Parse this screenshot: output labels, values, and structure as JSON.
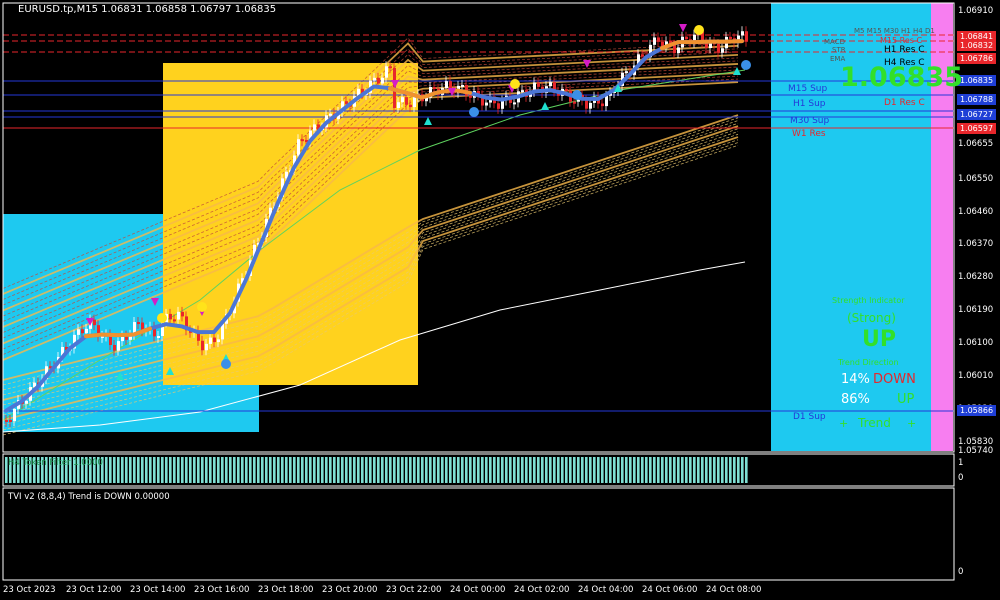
{
  "header": {
    "title": "EURUSD.tp,M15  1.06831 1.06858 1.06797 1.06835"
  },
  "price_axis": {
    "ticks": [
      "1.06910",
      "1.06655",
      "1.06550",
      "1.06460",
      "1.06370",
      "1.06280",
      "1.06190",
      "1.06100",
      "1.06010",
      "1.05920",
      "1.05830",
      "1.05740"
    ],
    "boxes": [
      {
        "value": "1.06841",
        "color": "#e8262b"
      },
      {
        "value": "1.06832",
        "color": "#e8262b"
      },
      {
        "value": "1.06786",
        "color": "#e8262b"
      },
      {
        "value": "1.06835",
        "color": "#1f3fd6"
      },
      {
        "value": "1.06788",
        "color": "#1f3fd6"
      },
      {
        "value": "1.06727",
        "color": "#1f3fd6"
      },
      {
        "value": "1.06597",
        "color": "#e8262b"
      },
      {
        "value": "1.05866",
        "color": "#1f3fd6"
      }
    ]
  },
  "time_axis": [
    "23 Oct 2023",
    "23 Oct 12:00",
    "23 Oct 14:00",
    "23 Oct 16:00",
    "23 Oct 18:00",
    "23 Oct 20:00",
    "23 Oct 22:00",
    "24 Oct 00:00",
    "24 Oct 02:00",
    "24 Oct 04:00",
    "24 Oct 06:00",
    "24 Oct 08:00"
  ],
  "levels": {
    "m15_sup": "M15 Sup",
    "h1_sup": "H1 Sup",
    "m30_sup": "M30 Sup",
    "w1_res": "W1 Res",
    "d1_sup": "D1 Sup",
    "d1_res": "D1 Res C",
    "h4_res": "H4 Res C",
    "h1_res": "H1 Res C",
    "m15_res": "M15 Res C"
  },
  "panel": {
    "timeframes": "M5 M15 M30 H1 H4 D1",
    "rows": [
      "MACD",
      "STR",
      "EMA"
    ],
    "big_price": "1.06835",
    "strength_label": "Strength Indicator",
    "strength": "(Strong)",
    "direction": "UP",
    "direction_label": "Trend Direction",
    "down_pct": "14%",
    "down_word": "DOWN",
    "up_pct": "86%",
    "up_word": "UP",
    "trend_word": "Trend"
  },
  "subwindow1": {
    "label": "H4 Token Filter 1.0000",
    "axis_top": "1",
    "axis_bottom": "0"
  },
  "subwindow2": {
    "label": "TVI v2 (8,8,4) Trend is DOWN 0.00000",
    "axis_bottom": "0"
  },
  "colors": {
    "cyan_zone": "#1ec9f0",
    "magenta_zone": "#f77ef0",
    "yellow_zone": "#ffd21e",
    "band_orange": "#f7b84a",
    "ma_blue": "#4b76d6",
    "ma_orange": "#f0922e",
    "bar_teal": "#7fe0d4",
    "bull": "#ffffff",
    "bear": "#e8262b"
  }
}
